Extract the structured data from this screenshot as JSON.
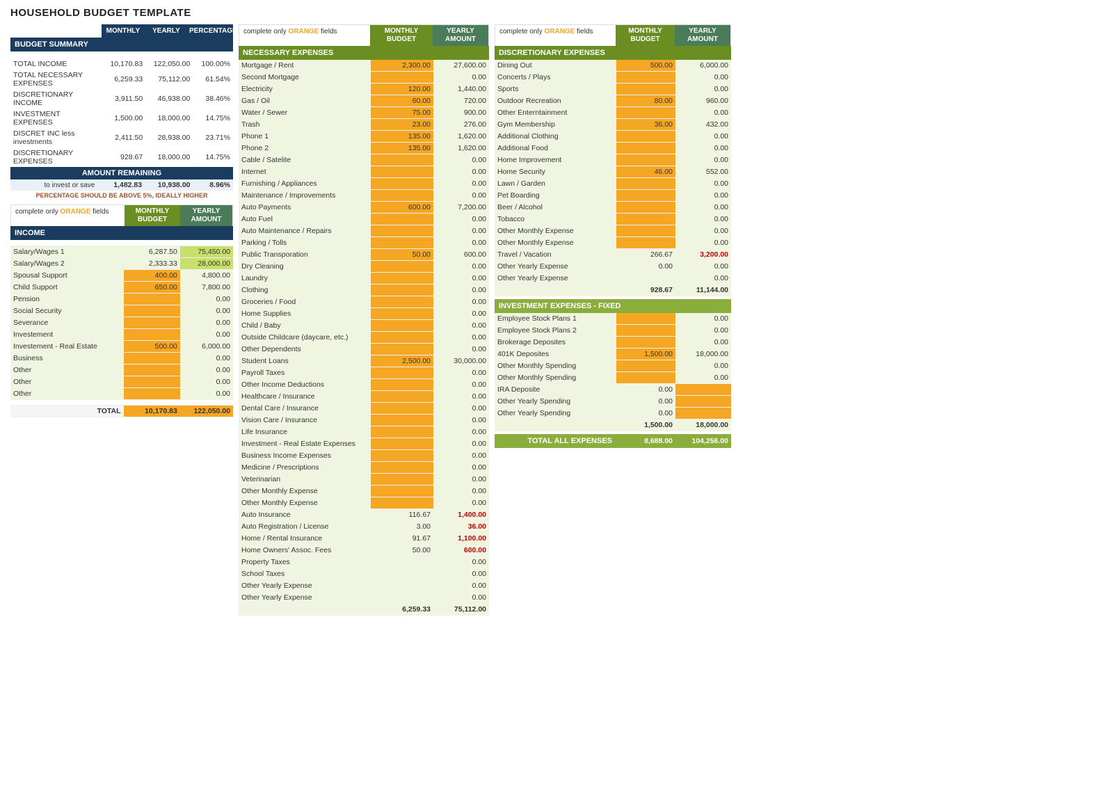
{
  "title": "HOUSEHOLD BUDGET TEMPLATE",
  "left": {
    "summary_header": {
      "monthly": "MONTHLY",
      "yearly": "YEARLY",
      "percentage": "PERCENTAGE"
    },
    "budget_summary_title": "BUDGET SUMMARY",
    "summary_rows": [
      {
        "label": "TOTAL INCOME",
        "monthly": "10,170.83",
        "yearly": "122,050.00",
        "pct": "100.00%"
      },
      {
        "label": "TOTAL NECESSARY EXPENSES",
        "monthly": "6,259.33",
        "yearly": "75,112.00",
        "pct": "61.54%"
      },
      {
        "label": "DISCRETIONARY INCOME",
        "monthly": "3,911.50",
        "yearly": "46,938.00",
        "pct": "38.46%"
      },
      {
        "label": "INVESTMENT EXPENSES",
        "monthly": "1,500.00",
        "yearly": "18,000.00",
        "pct": "14.75%"
      },
      {
        "label": "DISCRET INC less investments",
        "monthly": "2,411.50",
        "yearly": "28,938.00",
        "pct": "23.71%"
      },
      {
        "label": "DISCRETIONARY EXPENSES",
        "monthly": "928.67",
        "yearly": "18,000.00",
        "pct": "14.75%"
      }
    ],
    "amount_remaining_label": "AMOUNT REMAINING",
    "to_invest_label": "to invest or save",
    "amount_remaining_monthly": "1,482.83",
    "amount_remaining_yearly": "10,938.00",
    "amount_remaining_pct": "8.96%",
    "pct_note": "PERCENTAGE SHOULD BE ABOVE 5%, IDEALLY HIGHER",
    "income_header": {
      "col1": "MONTHLY BUDGET",
      "col2": "YEARLY AMOUNT"
    },
    "complete_note": "complete only",
    "orange_text": "ORANGE",
    "fields_text": "fields",
    "income_title": "INCOME",
    "income_rows": [
      {
        "label": "Salary/Wages 1",
        "monthly": "6,287.50",
        "yearly": "75,450.00",
        "monthly_orange": false,
        "yearly_orange": true
      },
      {
        "label": "Salary/Wages 2",
        "monthly": "2,333.33",
        "yearly": "28,000.00",
        "monthly_orange": false,
        "yearly_orange": true
      },
      {
        "label": "Spousal Support",
        "monthly": "400.00",
        "yearly": "4,800.00",
        "monthly_orange": true,
        "yearly_orange": false
      },
      {
        "label": "Child Support",
        "monthly": "650.00",
        "yearly": "7,800.00",
        "monthly_orange": true,
        "yearly_orange": false
      },
      {
        "label": "Pension",
        "monthly": "",
        "yearly": "0.00",
        "monthly_orange": true,
        "yearly_orange": false
      },
      {
        "label": "Social Security",
        "monthly": "",
        "yearly": "0.00",
        "monthly_orange": true,
        "yearly_orange": false
      },
      {
        "label": "Severance",
        "monthly": "",
        "yearly": "0.00",
        "monthly_orange": true,
        "yearly_orange": false
      },
      {
        "label": "Investement",
        "monthly": "",
        "yearly": "0.00",
        "monthly_orange": true,
        "yearly_orange": false
      },
      {
        "label": "Investement - Real Estate",
        "monthly": "500.00",
        "yearly": "6,000.00",
        "monthly_orange": true,
        "yearly_orange": false
      },
      {
        "label": "Business",
        "monthly": "",
        "yearly": "0.00",
        "monthly_orange": true,
        "yearly_orange": false
      },
      {
        "label": "Other",
        "monthly": "",
        "yearly": "0.00",
        "monthly_orange": true,
        "yearly_orange": false
      },
      {
        "label": "Other",
        "monthly": "",
        "yearly": "0.00",
        "monthly_orange": true,
        "yearly_orange": false
      },
      {
        "label": "Other",
        "monthly": "",
        "yearly": "0.00",
        "monthly_orange": true,
        "yearly_orange": false
      }
    ],
    "income_total_label": "TOTAL",
    "income_total_monthly": "10,170.83",
    "income_total_yearly": "122,050.00"
  },
  "middle": {
    "complete_note": "complete only",
    "orange_text": "ORANGE",
    "fields_text": "fields",
    "col_monthly": "MONTHLY BUDGET",
    "col_yearly": "YEARLY AMOUNT",
    "necessary_title": "NECESSARY EXPENSES",
    "necessary_rows": [
      {
        "label": "Mortgage / Rent",
        "monthly": "2,300.00",
        "yearly": "27,600.00",
        "monthly_orange": true
      },
      {
        "label": "Second Mortgage",
        "monthly": "",
        "yearly": "0.00",
        "monthly_orange": true
      },
      {
        "label": "Electricity",
        "monthly": "120.00",
        "yearly": "1,440.00",
        "monthly_orange": true
      },
      {
        "label": "Gas / Oil",
        "monthly": "60.00",
        "yearly": "720.00",
        "monthly_orange": true
      },
      {
        "label": "Water / Sewer",
        "monthly": "75.00",
        "yearly": "900.00",
        "monthly_orange": true
      },
      {
        "label": "Trash",
        "monthly": "23.00",
        "yearly": "276.00",
        "monthly_orange": true
      },
      {
        "label": "Phone 1",
        "monthly": "135.00",
        "yearly": "1,620.00",
        "monthly_orange": true
      },
      {
        "label": "Phone 2",
        "monthly": "135.00",
        "yearly": "1,620.00",
        "monthly_orange": true
      },
      {
        "label": "Cable / Satelite",
        "monthly": "",
        "yearly": "0.00",
        "monthly_orange": true
      },
      {
        "label": "Internet",
        "monthly": "",
        "yearly": "0.00",
        "monthly_orange": true
      },
      {
        "label": "Furnishing / Appliances",
        "monthly": "",
        "yearly": "0.00",
        "monthly_orange": true
      },
      {
        "label": "Maintenance / Improvements",
        "monthly": "",
        "yearly": "0.00",
        "monthly_orange": true
      },
      {
        "label": "Auto Payments",
        "monthly": "600.00",
        "yearly": "7,200.00",
        "monthly_orange": true
      },
      {
        "label": "Auto Fuel",
        "monthly": "",
        "yearly": "0.00",
        "monthly_orange": true
      },
      {
        "label": "Auto Maintenance / Repairs",
        "monthly": "",
        "yearly": "0.00",
        "monthly_orange": true
      },
      {
        "label": "Parking / Tolls",
        "monthly": "",
        "yearly": "0.00",
        "monthly_orange": true
      },
      {
        "label": "Public Transporation",
        "monthly": "50.00",
        "yearly": "600.00",
        "monthly_orange": true
      },
      {
        "label": "Dry Cleaning",
        "monthly": "",
        "yearly": "0.00",
        "monthly_orange": true
      },
      {
        "label": "Laundry",
        "monthly": "",
        "yearly": "0.00",
        "monthly_orange": true
      },
      {
        "label": "Clothing",
        "monthly": "",
        "yearly": "0.00",
        "monthly_orange": true
      },
      {
        "label": "Groceries / Food",
        "monthly": "",
        "yearly": "0.00",
        "monthly_orange": true
      },
      {
        "label": "Home Supplies",
        "monthly": "",
        "yearly": "0.00",
        "monthly_orange": true
      },
      {
        "label": "Child / Baby",
        "monthly": "",
        "yearly": "0.00",
        "monthly_orange": true
      },
      {
        "label": "Outside Childcare (daycare, etc.)",
        "monthly": "",
        "yearly": "0.00",
        "monthly_orange": true
      },
      {
        "label": "Other Dependents",
        "monthly": "",
        "yearly": "0.00",
        "monthly_orange": true
      },
      {
        "label": "Student Loans",
        "monthly": "2,500.00",
        "yearly": "30,000.00",
        "monthly_orange": true
      },
      {
        "label": "Payroll Taxes",
        "monthly": "",
        "yearly": "0.00",
        "monthly_orange": true
      },
      {
        "label": "Other Income Deductions",
        "monthly": "",
        "yearly": "0.00",
        "monthly_orange": true
      },
      {
        "label": "Healthcare / Insurance",
        "monthly": "",
        "yearly": "0.00",
        "monthly_orange": true
      },
      {
        "label": "Dental Care / Insurance",
        "monthly": "",
        "yearly": "0.00",
        "monthly_orange": true
      },
      {
        "label": "Vision Care / Insurance",
        "monthly": "",
        "yearly": "0.00",
        "monthly_orange": true
      },
      {
        "label": "Life Insurance",
        "monthly": "",
        "yearly": "0.00",
        "monthly_orange": true
      },
      {
        "label": "Investment - Real Estate Expenses",
        "monthly": "",
        "yearly": "0.00",
        "monthly_orange": true
      },
      {
        "label": "Business Income Expenses",
        "monthly": "",
        "yearly": "0.00",
        "monthly_orange": true
      },
      {
        "label": "Medicine / Prescriptions",
        "monthly": "",
        "yearly": "0.00",
        "monthly_orange": true
      },
      {
        "label": "Veterinarian",
        "monthly": "",
        "yearly": "0.00",
        "monthly_orange": true
      },
      {
        "label": "Other Monthly Expense",
        "monthly": "",
        "yearly": "0.00",
        "monthly_orange": true
      },
      {
        "label": "Other Monthly Expense",
        "monthly": "",
        "yearly": "0.00",
        "monthly_orange": true
      },
      {
        "label": "Auto Insurance",
        "monthly": "116.67",
        "yearly": "1,400.00",
        "monthly_orange": false,
        "yearly_highlight": true
      },
      {
        "label": "Auto Registration / License",
        "monthly": "3.00",
        "yearly": "36.00",
        "monthly_orange": false,
        "yearly_highlight": true
      },
      {
        "label": "Home / Rental Insurance",
        "monthly": "91.67",
        "yearly": "1,100.00",
        "monthly_orange": false,
        "yearly_highlight": true
      },
      {
        "label": "Home Owners' Assoc. Fees",
        "monthly": "50.00",
        "yearly": "600.00",
        "monthly_orange": false,
        "yearly_highlight": true
      },
      {
        "label": "Property Taxes",
        "monthly": "",
        "yearly": "0.00",
        "monthly_orange": false
      },
      {
        "label": "School Taxes",
        "monthly": "",
        "yearly": "0.00",
        "monthly_orange": false
      },
      {
        "label": "Other Yearly Expense",
        "monthly": "",
        "yearly": "0.00",
        "monthly_orange": false
      },
      {
        "label": "Other Yearly Expense",
        "monthly": "",
        "yearly": "0.00",
        "monthly_orange": false
      }
    ],
    "necessary_total_monthly": "6,259.33",
    "necessary_total_yearly": "75,112.00"
  },
  "right": {
    "complete_note": "complete only",
    "orange_text": "ORANGE",
    "fields_text": "fields",
    "col_monthly": "MONTHLY BUDGET",
    "col_yearly": "YEARLY AMOUNT",
    "discretionary_title": "DISCRETIONARY EXPENSES",
    "discretionary_rows": [
      {
        "label": "Dining Out",
        "monthly": "500.00",
        "yearly": "6,000.00",
        "monthly_orange": true
      },
      {
        "label": "Concerts / Plays",
        "monthly": "",
        "yearly": "0.00",
        "monthly_orange": true
      },
      {
        "label": "Sports",
        "monthly": "",
        "yearly": "0.00",
        "monthly_orange": true
      },
      {
        "label": "Outdoor Recreation",
        "monthly": "80.00",
        "yearly": "960.00",
        "monthly_orange": true
      },
      {
        "label": "Other Enterntainment",
        "monthly": "",
        "yearly": "0.00",
        "monthly_orange": true
      },
      {
        "label": "Gym Membership",
        "monthly": "36.00",
        "yearly": "432.00",
        "monthly_orange": true
      },
      {
        "label": "Additional Clothing",
        "monthly": "",
        "yearly": "0.00",
        "monthly_orange": true
      },
      {
        "label": "Additional Food",
        "monthly": "",
        "yearly": "0.00",
        "monthly_orange": true
      },
      {
        "label": "Home Improvement",
        "monthly": "",
        "yearly": "0.00",
        "monthly_orange": true
      },
      {
        "label": "Home Security",
        "monthly": "46.00",
        "yearly": "552.00",
        "monthly_orange": true
      },
      {
        "label": "Lawn / Garden",
        "monthly": "",
        "yearly": "0.00",
        "monthly_orange": true
      },
      {
        "label": "Pet Boarding",
        "monthly": "",
        "yearly": "0.00",
        "monthly_orange": true
      },
      {
        "label": "Beer / Alcohol",
        "monthly": "",
        "yearly": "0.00",
        "monthly_orange": true
      },
      {
        "label": "Tobacco",
        "monthly": "",
        "yearly": "0.00",
        "monthly_orange": true
      },
      {
        "label": "Other Monthly Expense",
        "monthly": "",
        "yearly": "0.00",
        "monthly_orange": true
      },
      {
        "label": "Other Monthly Expense",
        "monthly": "",
        "yearly": "0.00",
        "monthly_orange": true
      },
      {
        "label": "Travel / Vacation",
        "monthly": "266.67",
        "yearly": "3,200.00",
        "monthly_orange": false,
        "yearly_highlight": true
      },
      {
        "label": "Other Yearly Expense",
        "monthly": "0.00",
        "yearly": "0.00",
        "monthly_orange": false
      },
      {
        "label": "Other Yearly Expense",
        "monthly": "",
        "yearly": "0.00",
        "monthly_orange": false
      }
    ],
    "discretionary_total_monthly": "928.67",
    "discretionary_total_yearly": "11,144.00",
    "investment_title": "INVESTMENT EXPENSES - FIXED",
    "investment_rows": [
      {
        "label": "Employee Stock Plans 1",
        "monthly": "",
        "yearly": "0.00",
        "monthly_orange": true
      },
      {
        "label": "Employee Stock Plans 2",
        "monthly": "",
        "yearly": "0.00",
        "monthly_orange": true
      },
      {
        "label": "Brokerage Deposites",
        "monthly": "",
        "yearly": "0.00",
        "monthly_orange": true
      },
      {
        "label": "401K Deposites",
        "monthly": "1,500.00",
        "yearly": "18,000.00",
        "monthly_orange": true
      },
      {
        "label": "Other Monthly Spending",
        "monthly": "",
        "yearly": "0.00",
        "monthly_orange": true
      },
      {
        "label": "Other Monthly Spending",
        "monthly": "",
        "yearly": "0.00",
        "monthly_orange": true
      },
      {
        "label": "IRA Deposite",
        "monthly": "0.00",
        "yearly": "",
        "monthly_orange": false,
        "yearly_orange": true
      },
      {
        "label": "Other Yearly Spending",
        "monthly": "0.00",
        "yearly": "",
        "monthly_orange": false,
        "yearly_orange": true
      },
      {
        "label": "Other Yearly Spending",
        "monthly": "0.00",
        "yearly": "",
        "monthly_orange": false,
        "yearly_orange": true
      }
    ],
    "investment_total_monthly": "1,500.00",
    "investment_total_yearly": "18,000.00",
    "total_all_label": "TOTAL ALL EXPENSES",
    "total_all_monthly": "8,688.00",
    "total_all_yearly": "104,256.00"
  }
}
